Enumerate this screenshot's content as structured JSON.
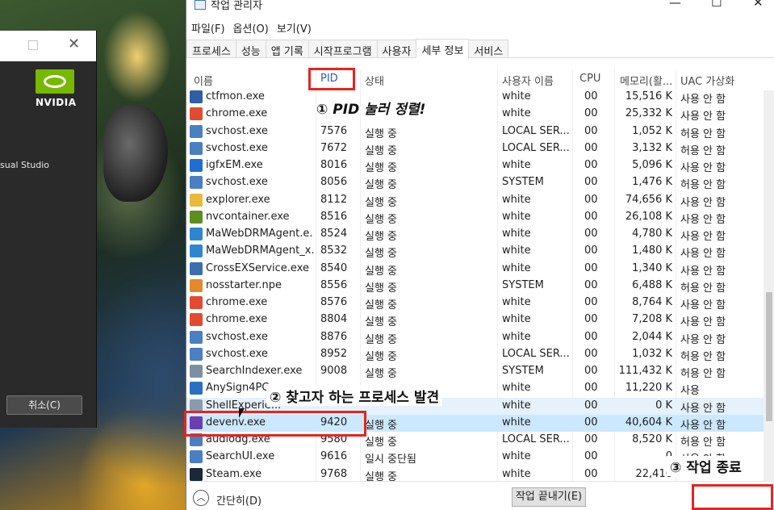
{
  "background": {
    "installer": {
      "brand": "NVIDIA",
      "partial_text": "sual Studio",
      "cancel_button": "취소(C)"
    }
  },
  "task_manager": {
    "title": "작업 관리자",
    "window_controls": [
      "—",
      "☐",
      "✕"
    ],
    "menu": [
      "파일(F)",
      "옵션(O)",
      "보기(V)"
    ],
    "tabs": [
      "프로세스",
      "성능",
      "앱 기록",
      "시작프로그램",
      "사용자",
      "세부 정보",
      "서비스"
    ],
    "active_tab": "세부 정보",
    "columns": {
      "name": "이름",
      "pid": "PID",
      "status": "상태",
      "user": "사용자 이름",
      "cpu": "CPU",
      "memory": "메모리(활...",
      "uac": "UAC 가상화"
    },
    "sorted_column": "PID",
    "rows": [
      {
        "name": "ctfmon.exe",
        "pid": "",
        "status": "",
        "user": "white",
        "cpu": "00",
        "memory": "15,516 K",
        "uac": "사용 안 함",
        "icon": "ctfmon-icon",
        "color": "#2f5fa5"
      },
      {
        "name": "chrome.exe",
        "pid": "",
        "status": "",
        "user": "white",
        "cpu": "00",
        "memory": "25,332 K",
        "uac": "사용 안 함",
        "icon": "chrome-icon",
        "color": "#e24a32"
      },
      {
        "name": "svchost.exe",
        "pid": "7576",
        "status": "실행 중",
        "user": "LOCAL SER...",
        "cpu": "00",
        "memory": "1,052 K",
        "uac": "허용 안 함",
        "icon": "svchost-icon",
        "color": "#4a7fc1"
      },
      {
        "name": "svchost.exe",
        "pid": "7672",
        "status": "실행 중",
        "user": "LOCAL SER...",
        "cpu": "00",
        "memory": "3,132 K",
        "uac": "허용 안 함",
        "icon": "svchost-icon",
        "color": "#4a7fc1"
      },
      {
        "name": "igfxEM.exe",
        "pid": "8016",
        "status": "실행 중",
        "user": "white",
        "cpu": "00",
        "memory": "5,096 K",
        "uac": "사용 안 함",
        "icon": "igfx-icon",
        "color": "#1f6fd1"
      },
      {
        "name": "svchost.exe",
        "pid": "8056",
        "status": "실행 중",
        "user": "SYSTEM",
        "cpu": "00",
        "memory": "1,476 K",
        "uac": "허용 안 함",
        "icon": "svchost-icon",
        "color": "#4a7fc1"
      },
      {
        "name": "explorer.exe",
        "pid": "8112",
        "status": "실행 중",
        "user": "white",
        "cpu": "00",
        "memory": "74,656 K",
        "uac": "사용 안 함",
        "icon": "explorer-icon",
        "color": "#e8b93a"
      },
      {
        "name": "nvcontainer.exe",
        "pid": "8516",
        "status": "실행 중",
        "user": "white",
        "cpu": "00",
        "memory": "26,108 K",
        "uac": "사용 안 함",
        "icon": "nvidia-icon",
        "color": "#5c8f1f"
      },
      {
        "name": "MaWebDRMAgent.e...",
        "pid": "8524",
        "status": "실행 중",
        "user": "white",
        "cpu": "00",
        "memory": "4,780 K",
        "uac": "사용 안 함",
        "icon": "drm-agent-icon",
        "color": "#2e86d1"
      },
      {
        "name": "MaWebDRMAgent_x...",
        "pid": "8532",
        "status": "실행 중",
        "user": "white",
        "cpu": "00",
        "memory": "1,480 K",
        "uac": "사용 안 함",
        "icon": "drm-agent-icon",
        "color": "#2e86d1"
      },
      {
        "name": "CrossEXService.exe",
        "pid": "8540",
        "status": "실행 중",
        "user": "white",
        "cpu": "00",
        "memory": "1,340 K",
        "uac": "사용 안 함",
        "icon": "service-icon",
        "color": "#3b6fb0"
      },
      {
        "name": "nosstarter.npe",
        "pid": "8556",
        "status": "실행 중",
        "user": "SYSTEM",
        "cpu": "00",
        "memory": "6,488 K",
        "uac": "허용 안 함",
        "icon": "nos-icon",
        "color": "#e28a2b"
      },
      {
        "name": "chrome.exe",
        "pid": "8576",
        "status": "실행 중",
        "user": "white",
        "cpu": "00",
        "memory": "8,764 K",
        "uac": "사용 안 함",
        "icon": "chrome-icon",
        "color": "#e24a32"
      },
      {
        "name": "chrome.exe",
        "pid": "8804",
        "status": "실행 중",
        "user": "white",
        "cpu": "00",
        "memory": "7,208 K",
        "uac": "사용 안 함",
        "icon": "chrome-icon",
        "color": "#e24a32"
      },
      {
        "name": "svchost.exe",
        "pid": "8876",
        "status": "실행 중",
        "user": "white",
        "cpu": "00",
        "memory": "2,044 K",
        "uac": "사용 안 함",
        "icon": "svchost-icon",
        "color": "#4a7fc1"
      },
      {
        "name": "svchost.exe",
        "pid": "8952",
        "status": "실행 중",
        "user": "LOCAL SER...",
        "cpu": "00",
        "memory": "1,032 K",
        "uac": "허용 안 함",
        "icon": "svchost-icon",
        "color": "#4a7fc1"
      },
      {
        "name": "SearchIndexer.exe",
        "pid": "9008",
        "status": "실행 중",
        "user": "SYSTEM",
        "cpu": "00",
        "memory": "111,432 K",
        "uac": "허용 안 함",
        "icon": "search-indexer-icon",
        "color": "#7d8fa3"
      },
      {
        "name": "AnySign4PC",
        "pid": "",
        "status": "",
        "user": "white",
        "cpu": "00",
        "memory": "11,220 K",
        "uac": "사용",
        "icon": "anysign-icon",
        "color": "#2a6fc4"
      },
      {
        "name": "ShellExperie...",
        "pid": "",
        "status": "",
        "user": "white",
        "cpu": "00",
        "memory": "0 K",
        "uac": "사용 안 함",
        "icon": "shell-icon",
        "color": "#8a9bb0"
      },
      {
        "name": "devenv.exe",
        "pid": "9420",
        "status": "실행 중",
        "user": "white",
        "cpu": "00",
        "memory": "40,604 K",
        "uac": "사용 안 함",
        "icon": "visual-studio-icon",
        "color": "#6b3fb2"
      },
      {
        "name": "audiodg.exe",
        "pid": "9580",
        "status": "실행 중",
        "user": "LOCAL SER...",
        "cpu": "00",
        "memory": "8,520 K",
        "uac": "허용 안 함",
        "icon": "audiodg-icon",
        "color": "#4a7fc1"
      },
      {
        "name": "SearchUI.exe",
        "pid": "9616",
        "status": "일시 중단됨",
        "user": "white",
        "cpu": "00",
        "memory": "0",
        "uac": "사용 안 함",
        "icon": "searchui-icon",
        "color": "#4a7fc1"
      },
      {
        "name": "Steam.exe",
        "pid": "9768",
        "status": "실행 중",
        "user": "white",
        "cpu": "00",
        "memory": "22,416",
        "uac": "",
        "icon": "steam-icon",
        "color": "#1b2838"
      }
    ],
    "footer": {
      "less_details": "간단히(D)",
      "end_task": "작업 끝내기(E)"
    }
  },
  "annotations": {
    "step1": "① PID 눌러 정렬!",
    "step2": "② 찾고자 하는 프로세스 발견",
    "step3": "③ 작업 종료",
    "highlight_color": "#e8231f"
  }
}
